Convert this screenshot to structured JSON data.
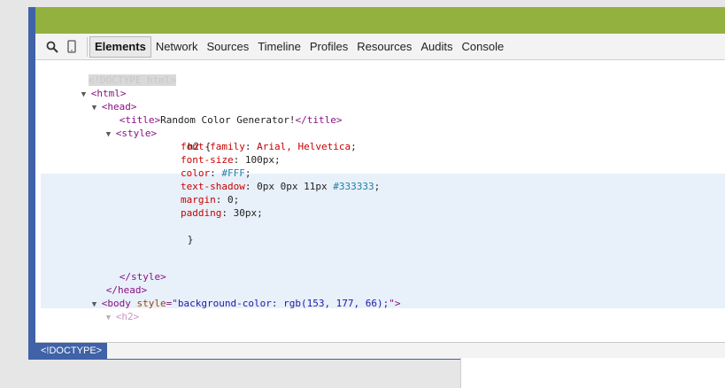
{
  "toolbar": {
    "search_icon": "magnifier",
    "device_icon": "mobile-device",
    "tabs": [
      "Elements",
      "Network",
      "Sources",
      "Timeline",
      "Profiles",
      "Resources",
      "Audits",
      "Console"
    ],
    "active_tab": "Elements"
  },
  "code": {
    "doctype": "<!DOCTYPE html>",
    "html_open": "html",
    "head_open": "head",
    "title_tag": "title",
    "title_text": "Random Color Generator!",
    "style_tag": "style",
    "selector": "h2 {",
    "declarations": [
      {
        "prop": "font-family",
        "value": "Arial, Helvetica",
        "hex": ""
      },
      {
        "prop": "font-size",
        "value": "100px",
        "hex": ""
      },
      {
        "prop": "color",
        "value": "",
        "hex": "#FFF"
      },
      {
        "prop": "text-shadow",
        "value": "0px 0px 11px ",
        "hex": "#333333"
      },
      {
        "prop": "margin",
        "value": "0",
        "hex": ""
      },
      {
        "prop": "padding",
        "value": "30px",
        "hex": ""
      }
    ],
    "close_brace": "}",
    "style_close": "style",
    "head_close": "head",
    "body_tag": "body",
    "body_attr": "style",
    "body_attr_value": "background-color: rgb(153, 177, 66);",
    "h2_partial": "<h2>"
  },
  "breadcrumb": {
    "label": "<!DOCTYPE>"
  },
  "colors": {
    "page_green": "#93b13f",
    "frame_blue": "#3f62a8",
    "highlight": "#e8f0fa"
  }
}
